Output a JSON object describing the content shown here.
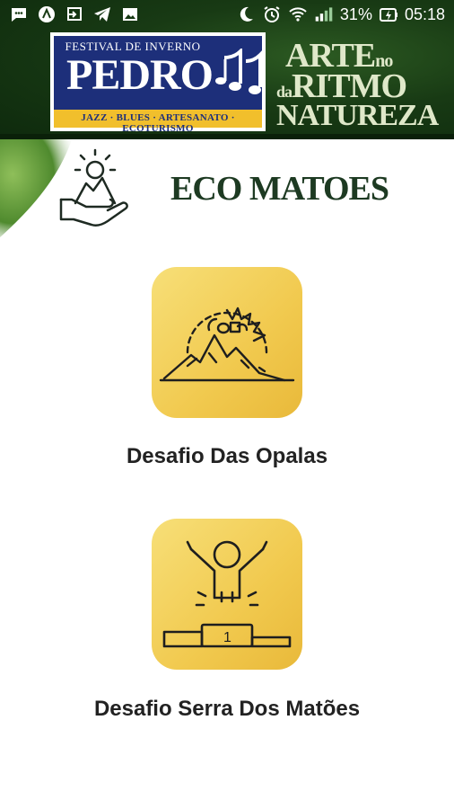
{
  "status_bar": {
    "battery": "31%",
    "time": "05:18",
    "icons": [
      "chat-icon",
      "app-icon",
      "cast-icon",
      "telegram-icon",
      "gallery-icon",
      "moon-icon",
      "alarm-icon",
      "wifi-icon",
      "signal-icon",
      "battery-icon"
    ]
  },
  "banner": {
    "festival_small": "FESTIVAL DE INVERNO",
    "festival_name": "PEDRO",
    "festival_tags": "JAZZ · BLUES · ARTESANATO · ECOTURISMO",
    "slogan_word1": "ARTE",
    "slogan_no": "no",
    "slogan_da": "da",
    "slogan_word2": "RITMO",
    "slogan_word3": "NATUREZA"
  },
  "page": {
    "title": "ECO MATOES"
  },
  "challenges": [
    {
      "label": "Desafio Das Opalas",
      "icon": "opal-mountain-icon"
    },
    {
      "label": "Desafio Serra Dos Matões",
      "icon": "winner-podium-icon"
    }
  ],
  "colors": {
    "banner_green": "#183a14",
    "logo_blue": "#1d2f7a",
    "logo_yellow": "#f1bf2c",
    "tile_yellow": "#f1c94e",
    "title_green": "#1d3a22"
  }
}
